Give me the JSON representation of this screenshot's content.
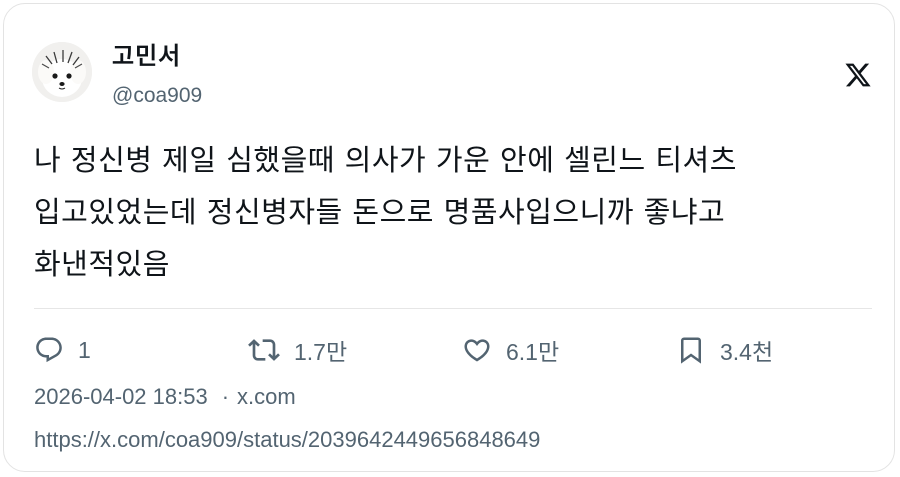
{
  "author": {
    "display_name": "고민서",
    "handle": "@coa909"
  },
  "icons": {
    "brand": "x-logo-icon",
    "reply": "reply-icon",
    "retweet": "retweet-icon",
    "like": "heart-icon",
    "bookmark": "bookmark-icon"
  },
  "tweet": {
    "text": "나 정신병 제일 심했을때 의사가 가운 안에 셀린느 티셔츠\n입고있었는데 정신병자들 돈으로 명품사입으니까 좋냐고\n화낸적있음"
  },
  "actions": {
    "reply_count": "1",
    "retweet_count": "1.7만",
    "like_count": "6.1만",
    "bookmark_count": "3.4천"
  },
  "meta": {
    "datetime": "2026-04-02 18:53",
    "separator": "·",
    "source": "x.com",
    "url": "https://x.com/coa909/status/2039642449656848649"
  },
  "colors": {
    "text": "#0f1419",
    "secondary": "#536471",
    "border": "#e3e3e3"
  }
}
